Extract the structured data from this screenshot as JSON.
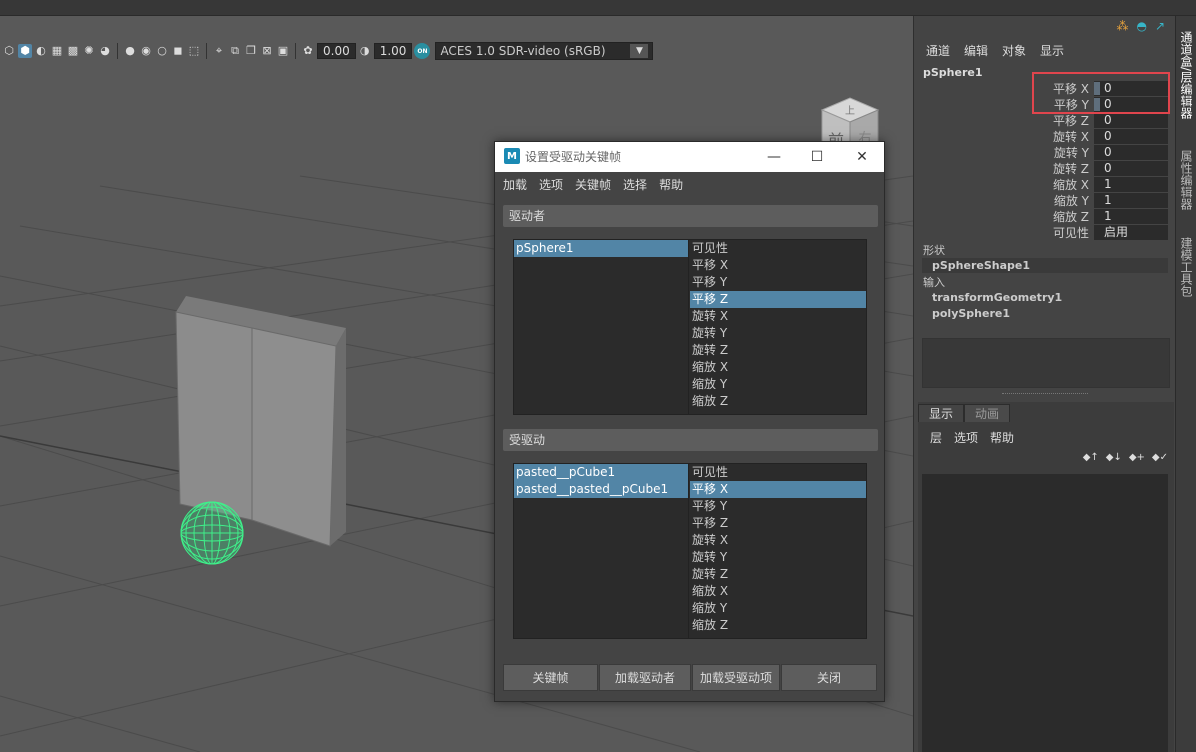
{
  "viewport": {
    "exposure": "0.00",
    "gamma": "1.00",
    "color_space": "ACES 1.0 SDR-video (sRGB)",
    "on_badge": "ON",
    "viewcube": {
      "top": "上",
      "front": "前",
      "right": "右"
    }
  },
  "channel_box": {
    "menu": [
      "通道",
      "编辑",
      "对象",
      "显示"
    ],
    "object_name": "pSphere1",
    "channels": [
      {
        "label": "平移 X",
        "value": "0"
      },
      {
        "label": "平移 Y",
        "value": "0"
      },
      {
        "label": "平移 Z",
        "value": "0"
      },
      {
        "label": "旋转 X",
        "value": "0"
      },
      {
        "label": "旋转 Y",
        "value": "0"
      },
      {
        "label": "旋转 Z",
        "value": "0"
      },
      {
        "label": "缩放 X",
        "value": "1"
      },
      {
        "label": "缩放 Y",
        "value": "1"
      },
      {
        "label": "缩放 Z",
        "value": "1"
      },
      {
        "label": "可见性",
        "value": "启用"
      }
    ],
    "shapes_label": "形状",
    "shape_node": "pSphereShape1",
    "inputs_label": "输入",
    "input_nodes": [
      "transformGeometry1",
      "polySphere1"
    ]
  },
  "layer_editor": {
    "tabs": [
      "显示",
      "动画"
    ],
    "menu": [
      "层",
      "选项",
      "帮助"
    ]
  },
  "side_tabs": [
    "通道盒/层编辑器",
    "属性编辑器",
    "建模工具包"
  ],
  "dialog": {
    "title": "设置受驱动关键帧",
    "window_buttons": {
      "minimize": "—",
      "maximize": "☐",
      "close": "✕"
    },
    "menu": [
      "加载",
      "选项",
      "关键帧",
      "选择",
      "帮助"
    ],
    "driver_header": "驱动者",
    "driver_objects": [
      "pSphere1"
    ],
    "driver_attrs": [
      "可见性",
      "平移 X",
      "平移 Y",
      "平移 Z",
      "旋转 X",
      "旋转 Y",
      "旋转 Z",
      "缩放 X",
      "缩放 Y",
      "缩放 Z"
    ],
    "driven_header": "受驱动",
    "driven_objects": [
      "pasted__pCube1",
      "pasted__pasted__pCube1"
    ],
    "driven_attrs": [
      "可见性",
      "平移 X",
      "平移 Y",
      "平移 Z",
      "旋转 X",
      "旋转 Y",
      "旋转 Z",
      "缩放 X",
      "缩放 Y",
      "缩放 Z"
    ],
    "buttons": [
      "关键帧",
      "加载驱动者",
      "加载受驱动项",
      "关闭"
    ]
  }
}
